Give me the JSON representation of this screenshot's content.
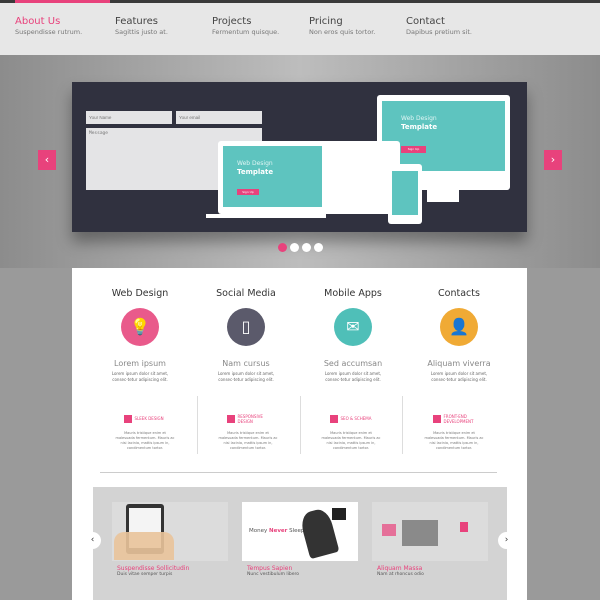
{
  "nav": {
    "items": [
      {
        "title": "About Us",
        "subtitle": "Suspendisse rutrum."
      },
      {
        "title": "Features",
        "subtitle": "Sagittis justo at."
      },
      {
        "title": "Projects",
        "subtitle": "Fermentum quisque."
      },
      {
        "title": "Pricing",
        "subtitle": "Non eros quis tortor."
      },
      {
        "title": "Contact",
        "subtitle": "Dapibus pretium sit."
      }
    ],
    "accent": "#e8427c"
  },
  "hero": {
    "name_placeholder": "Your Name",
    "email_placeholder": "Your email",
    "message_placeholder": "Message",
    "send_label": "Send",
    "device_title_1": "Web Design",
    "device_title_2": "Template",
    "device_button": "Sign Up",
    "slides": 4,
    "active_slide": 1
  },
  "features": [
    {
      "heading": "Web Design",
      "icon": "lightbulb-icon",
      "color": "#e95a8b",
      "title": "Lorem ipsum",
      "text": "Lorem ipsum dolor sit amet, consec-tetur adipiscing elit."
    },
    {
      "heading": "Social Media",
      "icon": "phone-icon",
      "color": "#5b5a6b",
      "title": "Nam cursus",
      "text": "Lorem ipsum dolor sit amet, consec-tetur adipiscing elit."
    },
    {
      "heading": "Mobile Apps",
      "icon": "envelope-icon",
      "color": "#4fbfb8",
      "title": "Sed accumsan",
      "text": "Lorem ipsum dolor sit amet, consec-tetur adipiscing elit."
    },
    {
      "heading": "Contacts",
      "icon": "add-user-icon",
      "color": "#f0aa35",
      "title": "Aliquam viverra",
      "text": "Lorem ipsum dolor sit amet, consec-tetur adipiscing elit."
    }
  ],
  "services": [
    {
      "title": "SLEEK DESIGN",
      "text": "Mauris tristique enim et malesuada fermentum. Mauris ac nisi lacinia, mattis ipsum in, condimentum tortor."
    },
    {
      "title": "RESPONSIVE DESIGN",
      "text": "Mauris tristique enim et malesuada fermentum. Mauris ac nisi lacinia, mattis ipsum in, condimentum tortor."
    },
    {
      "title": "SEO & SCHEMA",
      "text": "Mauris tristique enim et malesuada fermentum. Mauris ac nisi lacinia, mattis ipsum in, condimentum tortor."
    },
    {
      "title": "FRONT-END DEVELOPMENT",
      "text": "Mauris tristique enim et malesuada fermentum. Mauris ac nisi lacinia, mattis ipsum in, condimentum tortor."
    }
  ],
  "portfolio": [
    {
      "title": "Suspendisse Sollicitudin",
      "subtitle": "Duis vitae semper turpis"
    },
    {
      "title": "Tempus Sapien",
      "subtitle": "Nunc vestibulum libero",
      "image_text_1": "Money",
      "image_text_2": "Never",
      "image_text_3": "Sleeps"
    },
    {
      "title": "Aliquam Massa",
      "subtitle": "Nam at rhoncus odio"
    }
  ]
}
